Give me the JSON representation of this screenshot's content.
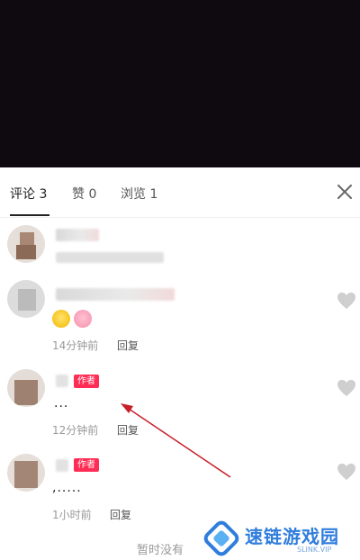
{
  "tabs": [
    {
      "label": "评论 3",
      "active": true
    },
    {
      "label": "赞 0",
      "active": false
    },
    {
      "label": "浏览 1",
      "active": false
    }
  ],
  "comments": [
    {
      "badge": "",
      "text": "",
      "time": "",
      "reply": ""
    },
    {
      "badge": "",
      "text": "",
      "time": "14分钟前",
      "reply": "回复"
    },
    {
      "badge": "作者",
      "text": "...",
      "time": "12分钟前",
      "reply": "回复"
    },
    {
      "badge": "作者",
      "text": ",.....",
      "time": "1小时前",
      "reply": "回复"
    }
  ],
  "footer": {
    "text": "暂时没有"
  },
  "watermark": {
    "brand": "速链游戏园",
    "sub": "SLINK.VIP"
  },
  "colors": {
    "accent": "#ff2d55",
    "video_bg": "#0e0a10",
    "annotation_arrow": "#c8202a"
  }
}
